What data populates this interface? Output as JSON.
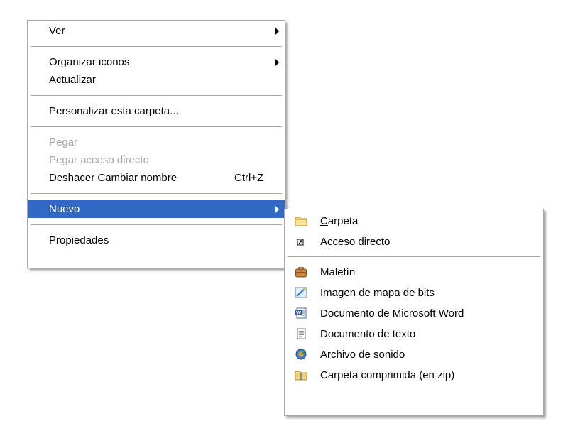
{
  "context_menu": {
    "items": [
      {
        "label": "Ver"
      },
      {
        "label": "Organizar iconos"
      },
      {
        "label": "Actualizar"
      },
      {
        "label": "Personalizar esta carpeta..."
      },
      {
        "label": "Pegar"
      },
      {
        "label": "Pegar acceso directo"
      },
      {
        "label": "Deshacer Cambiar nombre",
        "shortcut": "Ctrl+Z"
      },
      {
        "label": "Nuevo"
      },
      {
        "label": "Propiedades"
      }
    ]
  },
  "submenu_nuevo": {
    "items": [
      {
        "underlined": "C",
        "rest": "arpeta",
        "icon": "folder-icon"
      },
      {
        "underlined": "A",
        "rest": "cceso directo",
        "icon": "shortcut-icon"
      },
      {
        "label": "Maletín",
        "icon": "briefcase-icon"
      },
      {
        "label": "Imagen de mapa de bits",
        "icon": "bitmap-image-icon"
      },
      {
        "label": "Documento de Microsoft Word",
        "icon": "word-document-icon"
      },
      {
        "label": "Documento de texto",
        "icon": "text-document-icon"
      },
      {
        "label": "Archivo de sonido",
        "icon": "sound-file-icon"
      },
      {
        "label": "Carpeta comprimida (en zip)",
        "icon": "zip-folder-icon"
      }
    ]
  },
  "colors": {
    "highlight": "#316ac5",
    "disabled_text": "#a4a4a4",
    "separator": "#aca899"
  }
}
